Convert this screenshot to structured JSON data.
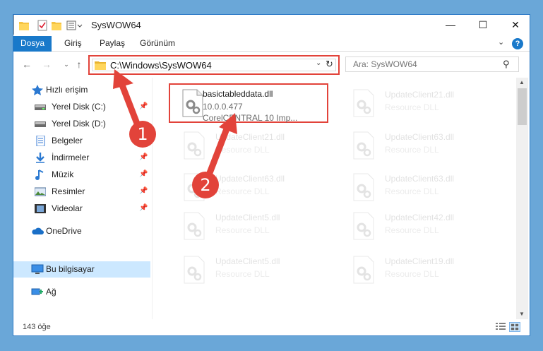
{
  "window": {
    "title": "SysWOW64"
  },
  "controls": {
    "minimize": "—",
    "maximize": "☐",
    "close": "✕"
  },
  "ribbon": {
    "tabs": [
      "Dosya",
      "Giriş",
      "Paylaş",
      "Görünüm"
    ],
    "expand": "⌄",
    "help": "?"
  },
  "nav": {
    "back": "←",
    "forward": "→",
    "recent": "⌄",
    "up": "↑"
  },
  "address": {
    "path": "C:\\Windows\\SysWOW64",
    "dropdown": "⌄",
    "refresh": "↻"
  },
  "search": {
    "placeholder": "Ara: SysWOW64",
    "icon": "⚲"
  },
  "sidebar": {
    "pin": "📌",
    "items": [
      {
        "label": "Hızlı erişim",
        "icon": "star-icon"
      },
      {
        "label": "Yerel Disk (C:)",
        "icon": "drive-icon",
        "pinned": true
      },
      {
        "label": "Yerel Disk (D:)",
        "icon": "drive-icon"
      },
      {
        "label": "Belgeler",
        "icon": "documents-icon"
      },
      {
        "label": "İndirmeler",
        "icon": "download-icon",
        "pinned": true
      },
      {
        "label": "Müzik",
        "icon": "music-icon",
        "pinned": true
      },
      {
        "label": "Resimler",
        "icon": "pictures-icon",
        "pinned": true
      },
      {
        "label": "Videolar",
        "icon": "videos-icon",
        "pinned": true
      },
      {
        "label": "OneDrive",
        "icon": "cloud-icon"
      },
      {
        "label": "Bu bilgisayar",
        "icon": "computer-icon",
        "selected": true
      },
      {
        "label": "Ağ",
        "icon": "network-icon"
      }
    ]
  },
  "files": {
    "highlighted": {
      "name": "basictableddata.dll",
      "version": "10.0.0.477",
      "company": "CorelCENTRAL 10 Imp..."
    },
    "faded": [
      {
        "name": "UpdateClient21.dll",
        "type": "Resource DLL"
      },
      {
        "name": "UpdateClient21.dll",
        "type": "Resource DLL"
      },
      {
        "name": "UpdateClient63.dll",
        "type": "Resource DLL"
      },
      {
        "name": "UpdateClient63.dll",
        "type": "Resource DLL"
      },
      {
        "name": "UpdateClient63.dll",
        "type": "Resource DLL"
      },
      {
        "name": "UpdateClient5.dll",
        "type": "Resource DLL"
      },
      {
        "name": "UpdateClient42.dll",
        "type": "Resource DLL"
      },
      {
        "name": "UpdateClient5.dll",
        "type": "Resource DLL"
      },
      {
        "name": "UpdateClient19.dll",
        "type": "Resource DLL"
      }
    ]
  },
  "scrollbar": {
    "up": "▲",
    "down": "▼"
  },
  "status": {
    "count": "143 öğe"
  },
  "annotations": {
    "step1": "1",
    "step2": "2",
    "color": "#e2433a"
  }
}
